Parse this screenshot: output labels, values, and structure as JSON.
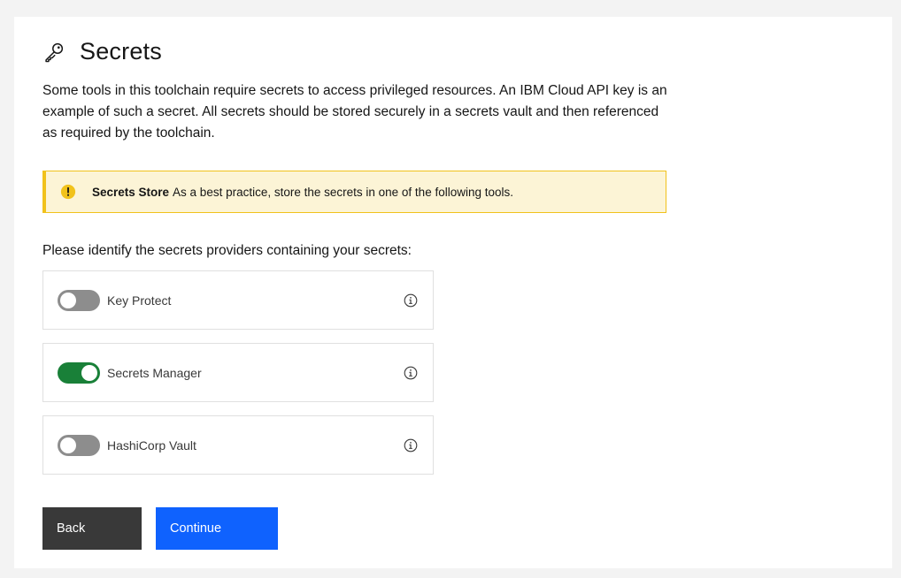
{
  "header": {
    "title": "Secrets",
    "icon": "key-icon"
  },
  "intro": {
    "text": "Some tools in this toolchain require secrets to access privileged resources. An IBM Cloud API key is an example of such a secret. All secrets should be stored securely in a secrets vault and then referenced as required by the toolchain."
  },
  "notice": {
    "icon": "warning-filled-icon",
    "title": "Secrets Store",
    "message": "As a best practice, store the secrets in one of the following tools.",
    "accent_color": "#f1c21b",
    "background_color": "#fcf4d6"
  },
  "providers": {
    "prompt": "Please identify the secrets providers containing your secrets:",
    "items": [
      {
        "label": "Key Protect",
        "enabled": false
      },
      {
        "label": "Secrets Manager",
        "enabled": true
      },
      {
        "label": "HashiCorp Vault",
        "enabled": false
      }
    ],
    "toggle_on_color": "#198038",
    "toggle_off_color": "#8d8d8d"
  },
  "actions": {
    "back_label": "Back",
    "continue_label": "Continue",
    "primary_color": "#0f62fe",
    "secondary_color": "#393939"
  }
}
